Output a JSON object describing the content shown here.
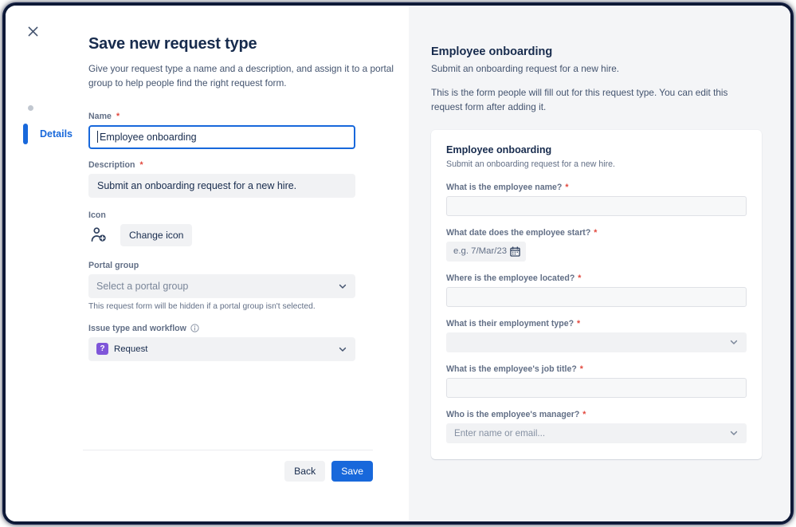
{
  "window": {
    "close_icon": "close-icon"
  },
  "stepper": {
    "steps": [
      {
        "label": "",
        "state": "dot"
      },
      {
        "label": "Details",
        "state": "active"
      }
    ]
  },
  "left": {
    "title": "Save new request type",
    "description": "Give your request type a name and a description, and assign it to a portal group to help people find the right request form.",
    "fields": {
      "name": {
        "label": "Name",
        "required": "*",
        "value": "Employee onboarding",
        "placeholder": "Employee onboarding"
      },
      "description": {
        "label": "Description",
        "required": "*",
        "value": "Submit an onboarding request for a new hire.",
        "placeholder": "Submit an onboarding request for a new hire."
      },
      "icon": {
        "label": "Icon",
        "icon_name": "person-add-icon",
        "change_button": "Change icon"
      },
      "portal_group": {
        "label": "Portal group",
        "value": "Select a portal group",
        "helper": "This request form will be hidden if a portal group isn't selected."
      },
      "issue_type": {
        "label": "Issue type and workflow",
        "info_icon": "info-icon",
        "badge_glyph": "?",
        "badge_color": "#7f56d9",
        "value": "Request"
      }
    },
    "footer": {
      "back_label": "Back",
      "save_label": "Save"
    }
  },
  "right": {
    "title": "Employee onboarding",
    "subtitle": "Submit an onboarding request for a new hire.",
    "note": "This is the form people will fill out for this request type. You can edit this request form after adding it.",
    "card": {
      "title": "Employee onboarding",
      "subtitle": "Submit an onboarding request for a new hire.",
      "fields": [
        {
          "label": "What is the employee name?",
          "required": "*",
          "type": "text",
          "value": "",
          "placeholder": ""
        },
        {
          "label": "What date does the employee start?",
          "required": "*",
          "type": "date",
          "value": "",
          "placeholder": "e.g. 7/Mar/23",
          "icon_name": "calendar-icon"
        },
        {
          "label": "Where is the employee located?",
          "required": "*",
          "type": "text",
          "value": "",
          "placeholder": ""
        },
        {
          "label": "What is their employment type?",
          "required": "*",
          "type": "select",
          "value": "",
          "placeholder": ""
        },
        {
          "label": "What is the employee's job title?",
          "required": "*",
          "type": "text",
          "value": "",
          "placeholder": ""
        },
        {
          "label": "Who is the employee's manager?",
          "required": "*",
          "type": "select",
          "value": "",
          "placeholder": "Enter name or email..."
        }
      ]
    }
  },
  "colors": {
    "accent": "#1868db",
    "required": "#e2483d",
    "badge_purple": "#7f56d9",
    "panel_bg": "#f4f5f7",
    "field_bg": "#f1f2f4"
  }
}
